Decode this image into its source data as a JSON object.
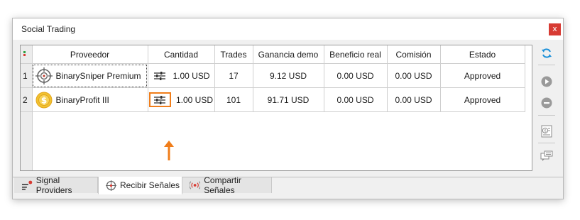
{
  "window": {
    "title": "Social Trading",
    "close_label": "x"
  },
  "grid": {
    "columns": [
      "Proveedor",
      "Cantidad",
      "Trades",
      "Ganancia demo",
      "Beneficio real",
      "Comisión",
      "Estado"
    ],
    "rows": [
      {
        "index": "1",
        "provider": "BinarySniper Premium",
        "icon": "crosshair-target-icon",
        "amount": "1.00 USD",
        "trades": "17",
        "demo_profit": "9.12 USD",
        "real_profit": "0.00 USD",
        "commission": "0.00 USD",
        "status": "Approved"
      },
      {
        "index": "2",
        "provider": "BinaryProfit III",
        "icon": "gold-dollar-coin-icon",
        "amount": "1.00 USD",
        "trades": "101",
        "demo_profit": "91.71 USD",
        "real_profit": "0.00 USD",
        "commission": "0.00 USD",
        "status": "Approved"
      }
    ]
  },
  "sidebar": [
    "refresh-icon",
    "play-icon",
    "remove-icon",
    "dollar-document-icon",
    "chat-icon"
  ],
  "tabs": [
    {
      "label": "Signal Providers",
      "icon": "signal-bars-icon",
      "active": false
    },
    {
      "label": "Recibir Señales",
      "icon": "crosshair-icon",
      "active": true
    },
    {
      "label": "Compartir Señales",
      "icon": "broadcast-icon",
      "active": false
    }
  ],
  "colors": {
    "highlight": "#f07d1a",
    "close": "#d73b33",
    "refresh": "#1a8fd8"
  }
}
